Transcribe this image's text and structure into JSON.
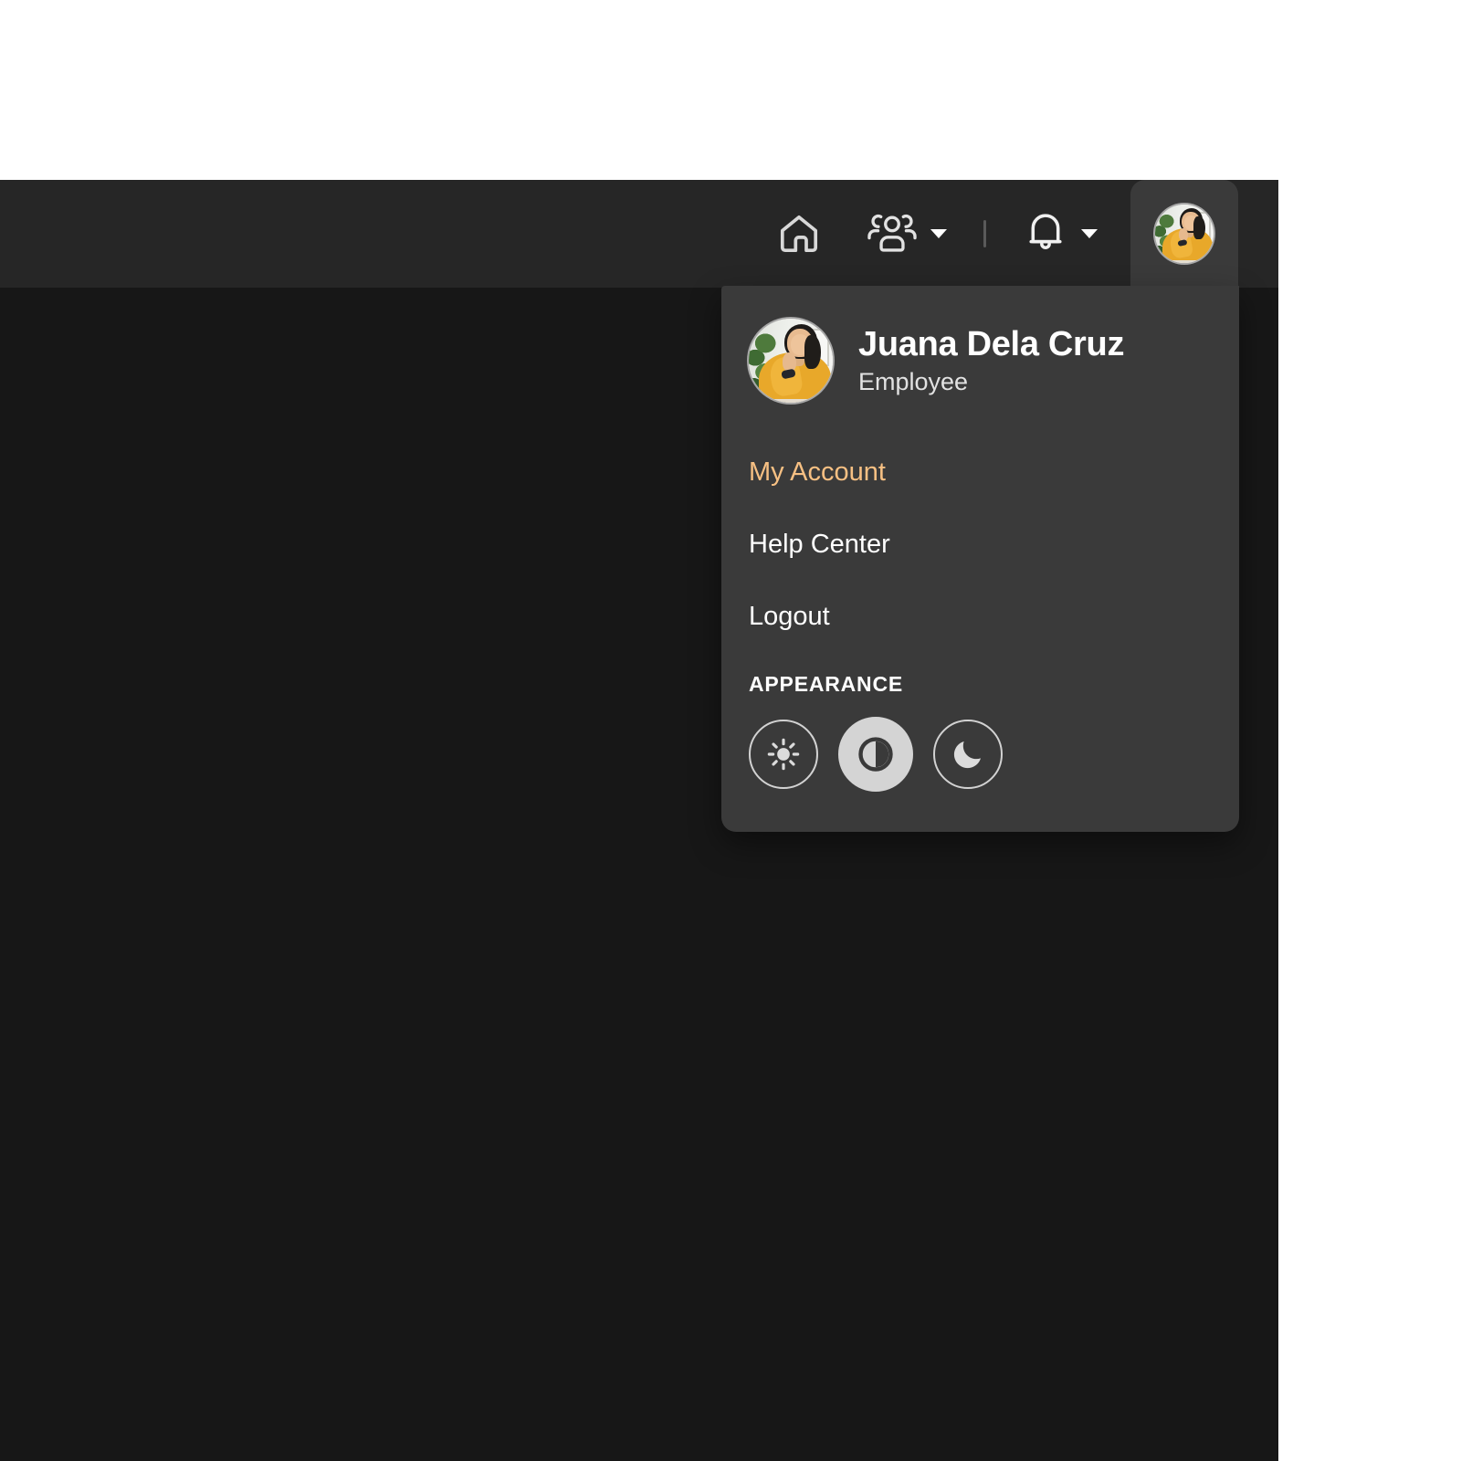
{
  "colors": {
    "page_background": "#ffffff",
    "app_background": "#171717",
    "navbar_background": "#262626",
    "dropdown_background": "#3a3a3a",
    "accent_orange": "#f7c083",
    "text_primary": "#ffffff",
    "text_secondary": "#e2e2e2",
    "icon_stroke": "#d8d8d8",
    "theme_selected_fill": "#d4d4d4"
  },
  "navbar": {
    "home_icon": "home-icon",
    "people_icon": "people-group-icon",
    "people_caret_icon": "chevron-down-icon",
    "divider": "vertical-divider",
    "notifications_icon": "bell-icon",
    "notifications_caret_icon": "chevron-down-icon",
    "avatar_icon": "user-avatar"
  },
  "dropdown": {
    "user": {
      "name": "Juana Dela Cruz",
      "role": "Employee",
      "avatar_icon": "user-avatar"
    },
    "menu_items": [
      {
        "label": "My Account",
        "accent": true
      },
      {
        "label": "Help Center",
        "accent": false
      },
      {
        "label": "Logout",
        "accent": false
      }
    ],
    "appearance": {
      "label": "APPEARANCE",
      "options": [
        {
          "name": "light",
          "icon": "sun-icon",
          "selected": false
        },
        {
          "name": "system",
          "icon": "contrast-half-circle-icon",
          "selected": true
        },
        {
          "name": "dark",
          "icon": "moon-icon",
          "selected": false
        }
      ]
    }
  }
}
